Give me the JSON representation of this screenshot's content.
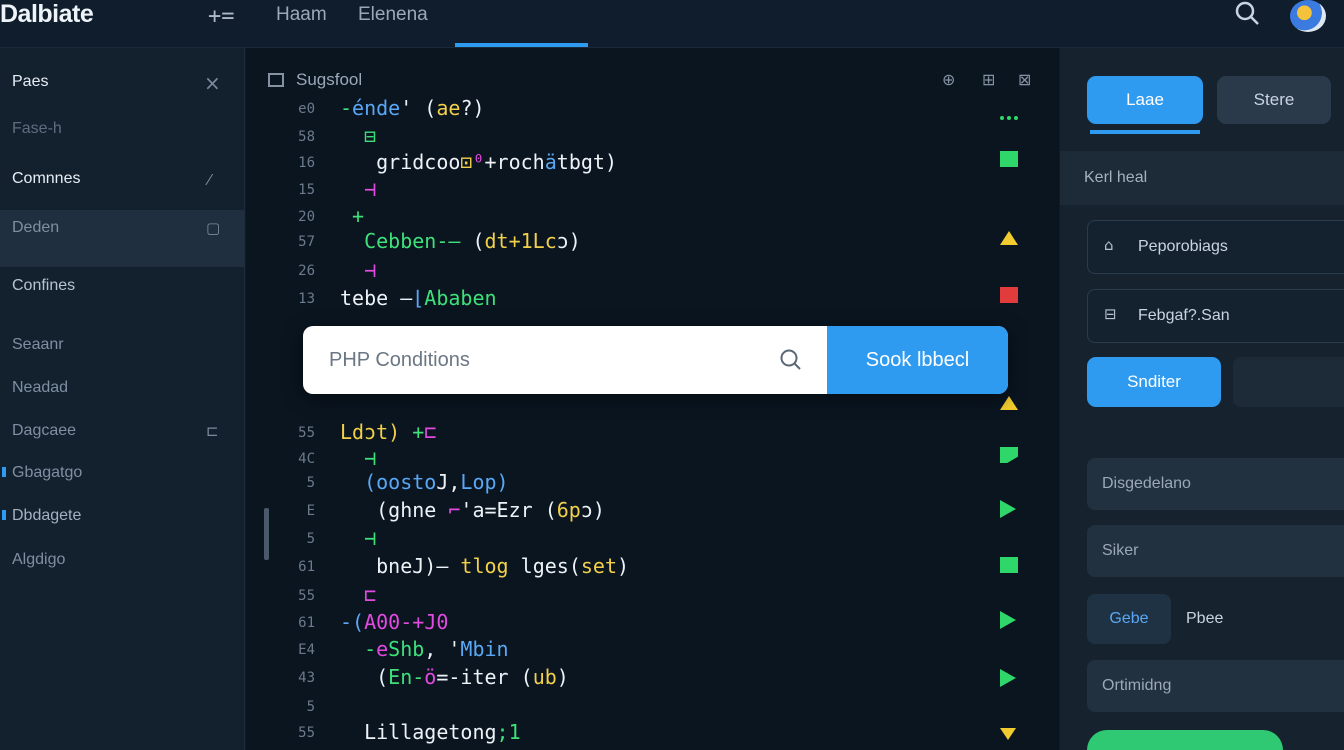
{
  "header": {
    "brand": "Dalbiate",
    "plus": "+=",
    "tabs": [
      "Haam",
      "Elenena"
    ]
  },
  "sidebar": {
    "items": [
      {
        "label": "Paes",
        "icon": "close-icon",
        "icon_char": "×"
      },
      {
        "label": "Fase-h"
      },
      {
        "label": "Comnnes",
        "icon": "edit-icon",
        "icon_char": "⁄"
      },
      {
        "label": "Deden",
        "icon": "square-icon",
        "icon_char": "▢"
      },
      {
        "label": "Confines"
      },
      {
        "label": "Seaanr"
      },
      {
        "label": "Neadad"
      },
      {
        "label": "Dagcaee",
        "icon": "bracket-icon",
        "icon_char": "⊏"
      },
      {
        "label": "Gbagatgo"
      },
      {
        "label": "Dbdagete"
      },
      {
        "label": "Algdigo"
      }
    ]
  },
  "editor": {
    "title": "Sugsfool",
    "controls": [
      "⊕",
      "⊞",
      "⊠"
    ],
    "lines": [
      {
        "n": "e0",
        "parts": [
          {
            "t": "-",
            "c": "green"
          },
          {
            "t": "énde",
            "c": "blue"
          },
          {
            "t": "' (",
            "c": "white"
          },
          {
            "t": "ae",
            "c": "yellow"
          },
          {
            "t": "?)",
            "c": "white"
          }
        ]
      },
      {
        "n": "58",
        "parts": [
          {
            "t": "  ⊟",
            "c": "green"
          }
        ]
      },
      {
        "n": "16",
        "parts": [
          {
            "t": "   gridcoo",
            "c": "white"
          },
          {
            "t": "⊡",
            "c": "yellow"
          },
          {
            "t": "⁰",
            "c": "pink"
          },
          {
            "t": "+roch",
            "c": "white"
          },
          {
            "t": "ä",
            "c": "blue"
          },
          {
            "t": "tbgt)",
            "c": "white"
          }
        ]
      },
      {
        "n": "15",
        "parts": [
          {
            "t": "  ⊣",
            "c": "pink"
          }
        ]
      },
      {
        "n": "20",
        "parts": [
          {
            "t": " +",
            "c": "green"
          }
        ]
      },
      {
        "n": "57",
        "parts": [
          {
            "t": "  Cebben-—",
            "c": "green"
          },
          {
            "t": " (",
            "c": "white"
          },
          {
            "t": "dt+1Lc",
            "c": "yellow"
          },
          {
            "t": "ɔ)",
            "c": "white"
          }
        ]
      },
      {
        "n": "26",
        "parts": [
          {
            "t": "  ⊣",
            "c": "pink"
          }
        ]
      },
      {
        "n": "13",
        "parts": [
          {
            "t": "tebe —",
            "c": "white"
          },
          {
            "t": "⌊",
            "c": "blue"
          },
          {
            "t": "Ababen",
            "c": "green"
          }
        ]
      },
      {
        "n": "55",
        "parts": [
          {
            "t": "Ldɔt)",
            "c": "yellow"
          },
          {
            "t": " +",
            "c": "green"
          },
          {
            "t": "⊏",
            "c": "pink"
          }
        ]
      },
      {
        "n": "4C",
        "parts": [
          {
            "t": "  ⊣",
            "c": "green"
          }
        ]
      },
      {
        "n": "5",
        "parts": [
          {
            "t": "  (oosto",
            "c": "blue"
          },
          {
            "t": "J",
            "c": "white"
          },
          {
            "t": ",",
            "c": "white"
          },
          {
            "t": "Lop)",
            "c": "blue"
          }
        ]
      },
      {
        "n": "E",
        "parts": [
          {
            "t": "   (ghne ",
            "c": "white"
          },
          {
            "t": "⌐",
            "c": "pink"
          },
          {
            "t": "'a=Ezr",
            "c": "white"
          },
          {
            "t": " (",
            "c": "white"
          },
          {
            "t": "6p",
            "c": "yellow"
          },
          {
            "t": "ɔ)",
            "c": "white"
          }
        ]
      },
      {
        "n": "5",
        "parts": [
          {
            "t": "  ⊣",
            "c": "green"
          }
        ]
      },
      {
        "n": "61",
        "parts": [
          {
            "t": "   bne",
            "c": "white"
          },
          {
            "t": "J",
            "c": "white"
          },
          {
            "t": ")—",
            "c": "white"
          },
          {
            "t": " tlog",
            "c": "yellow"
          },
          {
            "t": " lges(",
            "c": "white"
          },
          {
            "t": "set",
            "c": "yellow"
          },
          {
            "t": ")",
            "c": "white"
          }
        ]
      },
      {
        "n": "55",
        "parts": [
          {
            "t": "  ⊏",
            "c": "pink"
          }
        ]
      },
      {
        "n": "61",
        "parts": [
          {
            "t": "-(",
            "c": "blue"
          },
          {
            "t": "A00-+",
            "c": "pink"
          },
          {
            "t": "J0",
            "c": "pink"
          }
        ]
      },
      {
        "n": "E4",
        "parts": [
          {
            "t": "  -",
            "c": "green"
          },
          {
            "t": "e",
            "c": "pink"
          },
          {
            "t": "Shb",
            "c": "green"
          },
          {
            "t": ", '",
            "c": "white"
          },
          {
            "t": "Mbin",
            "c": "blue"
          }
        ]
      },
      {
        "n": "43",
        "parts": [
          {
            "t": "   (",
            "c": "white"
          },
          {
            "t": "En-",
            "c": "green"
          },
          {
            "t": "ö",
            "c": "pink"
          },
          {
            "t": "=-iter",
            "c": "white"
          },
          {
            "t": " (",
            "c": "white"
          },
          {
            "t": "ub",
            "c": "yellow"
          },
          {
            "t": ")",
            "c": "white"
          }
        ]
      },
      {
        "n": "5",
        "parts": []
      },
      {
        "n": "55",
        "parts": [
          {
            "t": "  Lillagetong",
            "c": "white"
          },
          {
            "t": ";1",
            "c": "green"
          }
        ]
      }
    ]
  },
  "search": {
    "placeholder": "PHP Conditions",
    "button_label": "Sook lbbecl"
  },
  "right_panel": {
    "tab_active": "Laae",
    "tab_other": "Stere",
    "section_label": "Kerl heal",
    "card1": "Peporobiags",
    "card2": "Febgaf?.San",
    "primary_button": "Snditer",
    "field1": "Disgedelano",
    "field2": "Siker",
    "small_button": "Gebe",
    "small_label": "Pbee",
    "field3": "Ortimidng"
  },
  "colors": {
    "accent": "#2f9bf0",
    "green": "#3ee07a",
    "yellow": "#f2d04a",
    "pink": "#e24ae0",
    "red": "#e23b3b"
  }
}
